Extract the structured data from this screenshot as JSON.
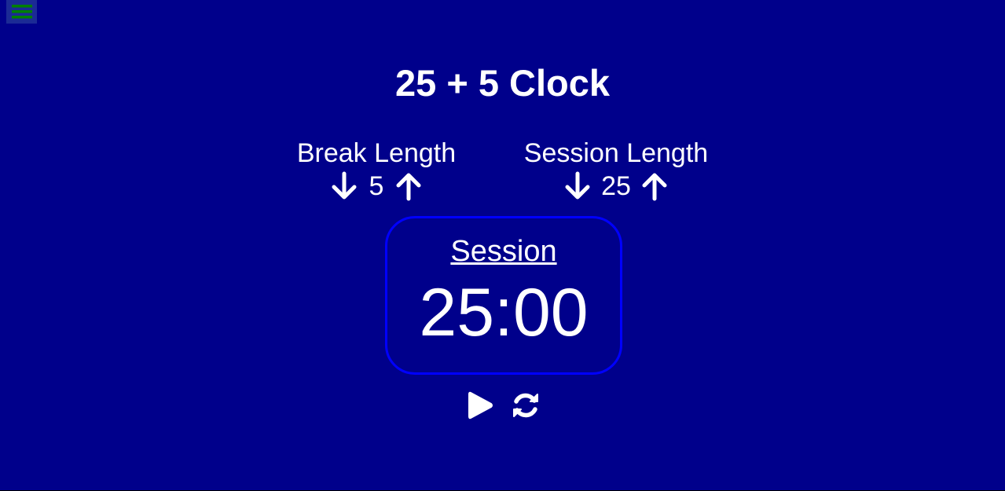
{
  "title": "25 + 5 Clock",
  "break": {
    "label": "Break Length",
    "value": "5"
  },
  "session": {
    "label": "Session Length",
    "value": "25"
  },
  "timer": {
    "label": "Session",
    "time_left": "25:00"
  },
  "icons": {
    "menu": "hamburger-menu-icon",
    "decrement": "arrow-down-icon",
    "increment": "arrow-up-icon",
    "play": "play-icon",
    "reset": "refresh-icon"
  },
  "colors": {
    "background": "#00008b",
    "timer_border": "#0000ff",
    "menu_bar": "#008000",
    "text": "#ffffff"
  }
}
